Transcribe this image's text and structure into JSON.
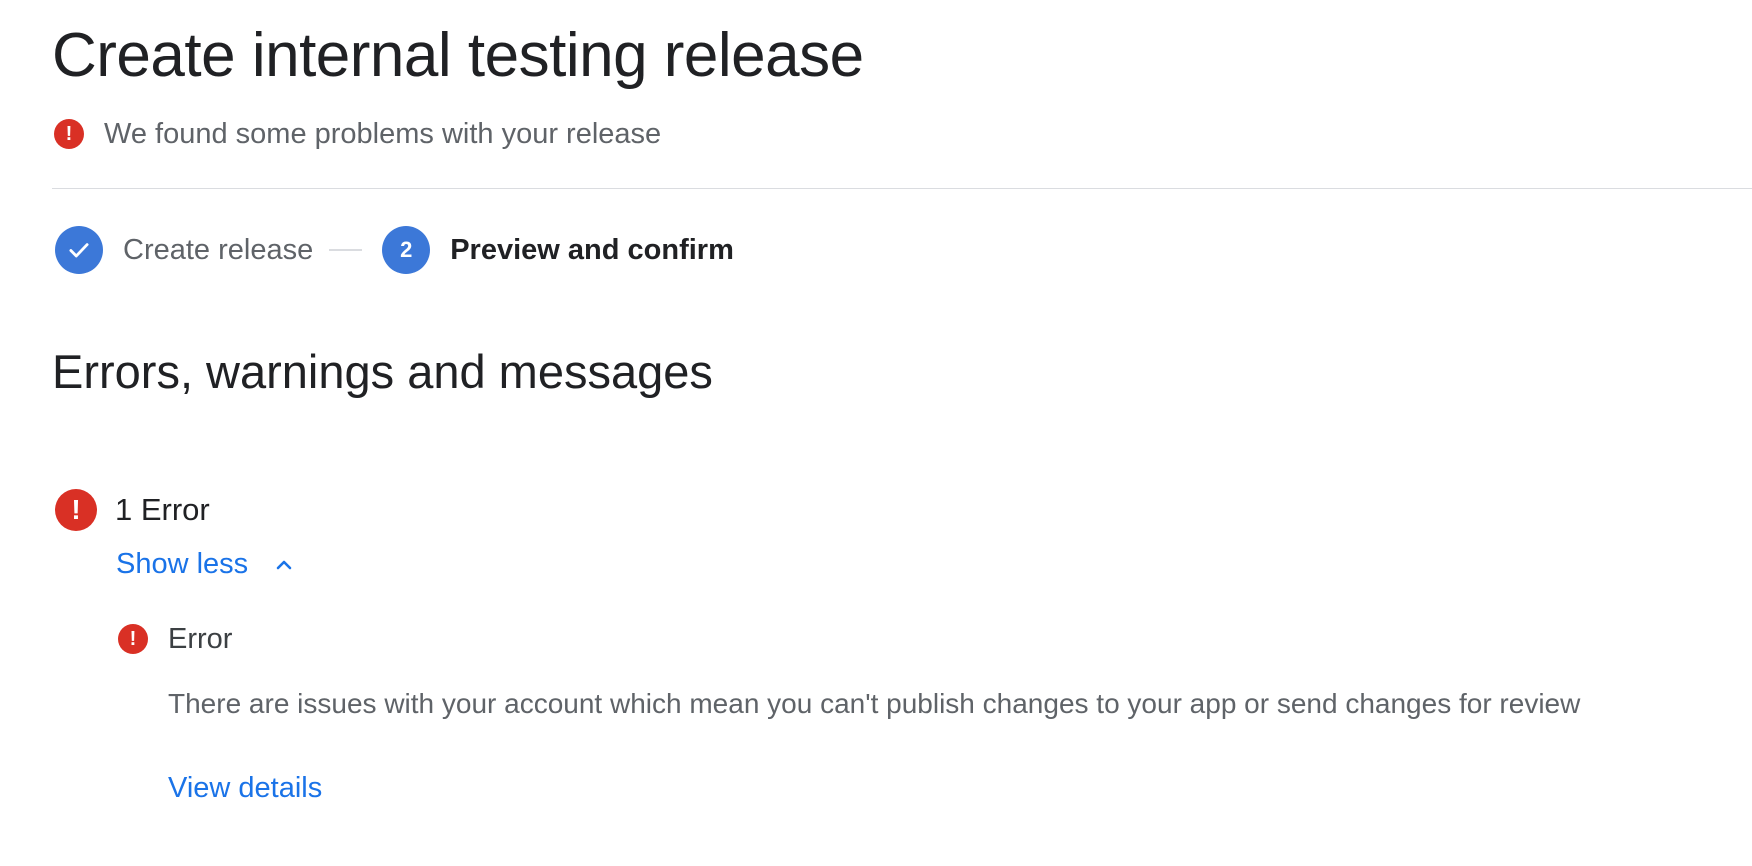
{
  "header": {
    "title": "Create internal testing release",
    "alert_icon": "error-icon",
    "alert_text": "We found some problems with your release"
  },
  "stepper": {
    "steps": [
      {
        "label": "Create release",
        "status": "completed",
        "icon": "check-icon"
      },
      {
        "label": "Preview and confirm",
        "status": "active",
        "number": "2"
      }
    ]
  },
  "section": {
    "title": "Errors, warnings and messages"
  },
  "errors": {
    "count_label": "1 Error",
    "toggle_label": "Show less",
    "toggle_icon": "chevron-up-icon",
    "items": [
      {
        "title": "Error",
        "description": "There are issues with your account which mean you can't publish changes to your app or send changes for review",
        "link_label": "View details"
      }
    ]
  },
  "colors": {
    "error": "#d93025",
    "accent": "#3c78d8",
    "link": "#1a73e8"
  }
}
